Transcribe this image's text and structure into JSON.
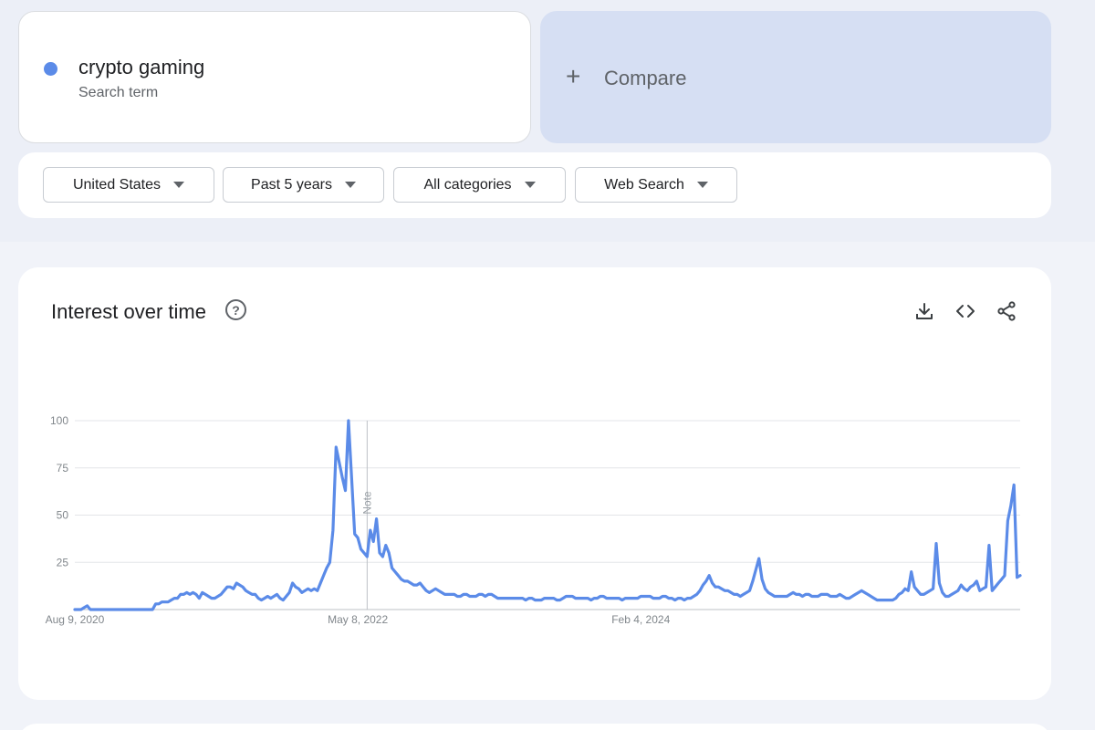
{
  "term": {
    "name": "crypto gaming",
    "subtitle": "Search term",
    "color": "#5b8be8"
  },
  "compare": {
    "label": "Compare"
  },
  "filters": [
    {
      "label": "United States"
    },
    {
      "label": "Past 5 years"
    },
    {
      "label": "All categories"
    },
    {
      "label": "Web Search"
    }
  ],
  "chart_card": {
    "title": "Interest over time",
    "icons": [
      "download-icon",
      "embed-code-icon",
      "share-icon",
      "help-icon"
    ]
  },
  "chart_data": {
    "type": "line",
    "y_ticks": [
      "100",
      "75",
      "50",
      "25"
    ],
    "ylim": [
      0,
      100
    ],
    "x_tick_labels": [
      "Aug 9, 2020",
      "May 8, 2022",
      "Feb 4, 2024"
    ],
    "x_range": [
      "Aug 9, 2020",
      "Oct 2025"
    ],
    "annotation": {
      "label": "Note",
      "x": "Jan 2022"
    },
    "grid": true,
    "series": [
      {
        "color": "#5b8be8",
        "values": [
          0,
          0,
          0,
          1,
          2,
          0,
          0,
          0,
          0,
          0,
          0,
          0,
          0,
          0,
          0,
          0,
          0,
          0,
          0,
          0,
          0,
          0,
          0,
          0,
          0,
          0,
          3,
          3,
          4,
          4,
          4,
          5,
          6,
          6,
          8,
          8,
          9,
          8,
          9,
          8,
          6,
          9,
          8,
          7,
          6,
          6,
          7,
          8,
          10,
          12,
          12,
          11,
          14,
          13,
          12,
          10,
          9,
          8,
          8,
          6,
          5,
          6,
          7,
          6,
          7,
          8,
          6,
          5,
          7,
          9,
          14,
          12,
          11,
          9,
          10,
          11,
          10,
          11,
          10,
          14,
          18,
          22,
          25,
          42,
          86,
          78,
          70,
          63,
          100,
          70,
          40,
          38,
          32,
          30,
          28,
          42,
          36,
          48,
          30,
          28,
          34,
          30,
          22,
          20,
          18,
          16,
          15,
          15,
          14,
          13,
          13,
          14,
          12,
          10,
          9,
          10,
          11,
          10,
          9,
          8,
          8,
          8,
          8,
          7,
          7,
          8,
          8,
          7,
          7,
          7,
          8,
          8,
          7,
          8,
          8,
          7,
          6,
          6,
          6,
          6,
          6,
          6,
          6,
          6,
          6,
          5,
          6,
          6,
          5,
          5,
          5,
          6,
          6,
          6,
          6,
          5,
          5,
          6,
          7,
          7,
          7,
          6,
          6,
          6,
          6,
          6,
          5,
          6,
          6,
          7,
          7,
          6,
          6,
          6,
          6,
          6,
          5,
          6,
          6,
          6,
          6,
          6,
          7,
          7,
          7,
          7,
          6,
          6,
          6,
          7,
          7,
          6,
          6,
          5,
          6,
          6,
          5,
          6,
          6,
          7,
          8,
          10,
          13,
          15,
          18,
          14,
          12,
          12,
          11,
          10,
          10,
          9,
          8,
          8,
          7,
          8,
          9,
          10,
          15,
          21,
          27,
          16,
          11,
          9,
          8,
          7,
          7,
          7,
          7,
          7,
          8,
          9,
          8,
          8,
          7,
          8,
          8,
          7,
          7,
          7,
          8,
          8,
          8,
          7,
          7,
          7,
          8,
          7,
          6,
          6,
          7,
          8,
          9,
          10,
          9,
          8,
          7,
          6,
          5,
          5,
          5,
          5,
          5,
          5,
          6,
          8,
          9,
          11,
          10,
          20,
          12,
          10,
          8,
          8,
          9,
          10,
          11,
          35,
          14,
          9,
          7,
          7,
          8,
          9,
          10,
          13,
          11,
          10,
          12,
          13,
          15,
          10,
          11,
          12,
          34,
          10,
          12,
          14,
          16,
          18,
          47,
          55,
          66,
          17,
          18
        ]
      }
    ]
  }
}
